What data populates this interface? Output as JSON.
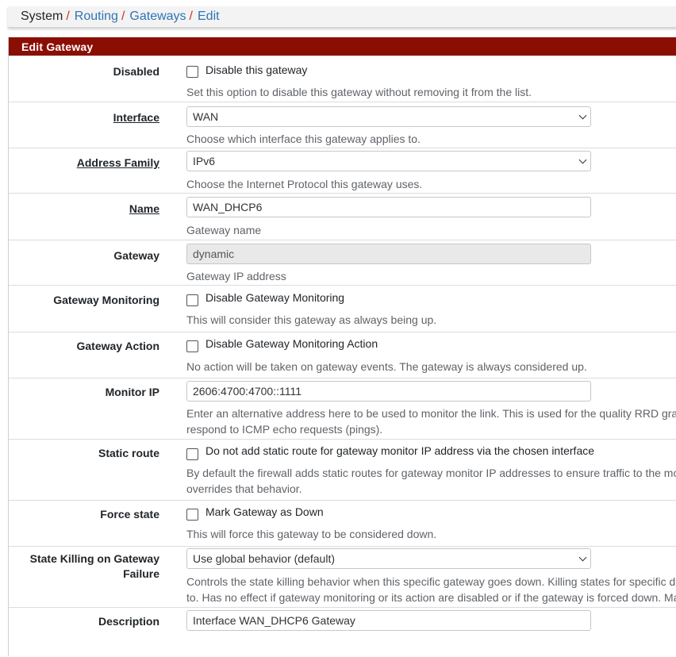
{
  "breadcrumb": {
    "items": [
      "System",
      "Routing",
      "Gateways",
      "Edit"
    ],
    "separator": "/"
  },
  "panel": {
    "title": "Edit Gateway"
  },
  "form": {
    "disabled": {
      "label": "Disabled",
      "checkbox_label": "Disable this gateway",
      "checked": false,
      "help": "Set this option to disable this gateway without removing it from the list."
    },
    "interface": {
      "label": "Interface",
      "value": "WAN",
      "help": "Choose which interface this gateway applies to."
    },
    "address_family": {
      "label": "Address Family",
      "value": "IPv6",
      "help": "Choose the Internet Protocol this gateway uses."
    },
    "name": {
      "label": "Name",
      "value": "WAN_DHCP6",
      "help": "Gateway name"
    },
    "gateway": {
      "label": "Gateway",
      "value": "dynamic",
      "help": "Gateway IP address"
    },
    "gateway_monitoring": {
      "label": "Gateway Monitoring",
      "checkbox_label": "Disable Gateway Monitoring",
      "checked": false,
      "help": "This will consider this gateway as always being up."
    },
    "gateway_action": {
      "label": "Gateway Action",
      "checkbox_label": "Disable Gateway Monitoring Action",
      "checked": false,
      "help": "No action will be taken on gateway events. The gateway is always considered up."
    },
    "monitor_ip": {
      "label": "Monitor IP",
      "value": "2606:4700:4700::1111",
      "help_line1": "Enter an alternative address here to be used to monitor the link. This is used for the quality RRD graphs",
      "help_line2": "respond to ICMP echo requests (pings)."
    },
    "static_route": {
      "label": "Static route",
      "checkbox_label": "Do not add static route for gateway monitor IP address via the chosen interface",
      "checked": false,
      "help_line1": "By default the firewall adds static routes for gateway monitor IP addresses to ensure traffic to the monit",
      "help_line2": "overrides that behavior."
    },
    "force_state": {
      "label": "Force state",
      "checkbox_label": "Mark Gateway as Down",
      "checked": false,
      "help": "This will force this gateway to be considered down."
    },
    "state_killing": {
      "label": "State Killing on Gateway Failure",
      "value": "Use global behavior (default)",
      "help_line1": "Controls the state killing behavior when this specific gateway goes down. Killing states for specific down",
      "help_line2": "to. Has no effect if gateway monitoring or its action are disabled or if the gateway is forced down. May n"
    },
    "description": {
      "label": "Description",
      "value": "Interface WAN_DHCP6 Gateway"
    }
  },
  "colors": {
    "panel_heading_bg": "#8b0e04",
    "link": "#2e74b5",
    "separator": "#c0392b"
  }
}
